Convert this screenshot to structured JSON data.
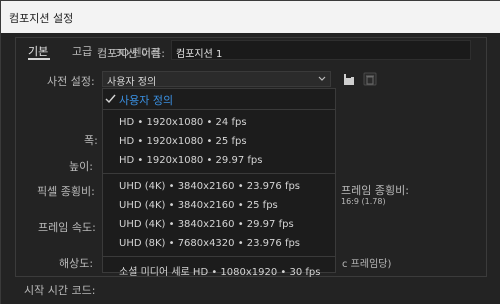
{
  "window": {
    "title": "컴포지션 설정"
  },
  "composition": {
    "name_label": "컴포지션 이름:",
    "name_value": "컴포지션 1"
  },
  "tabs": [
    "기본",
    "고급",
    "3D 렌더러"
  ],
  "form": {
    "preset_label": "사전 설정:",
    "width_label": "폭:",
    "height_label": "높이:",
    "pixel_aspect_label": "픽셀 종횡비:",
    "frame_rate_label": "프레임 속도:",
    "resolution_label": "해상도:",
    "start_timecode_label": "시작 시간 코드:"
  },
  "preset": {
    "value": "사용자 정의"
  },
  "right": {
    "frame_aspect_label": "프레임 종횡비:",
    "frame_aspect_value": "16:9 (1.78)",
    "per_frame_text": "c 프레임당)"
  },
  "dropdown": {
    "items": [
      {
        "label": "사용자 정의",
        "selected": true
      },
      {
        "label": "HD • 1920x1080 • 24 fps"
      },
      {
        "label": "HD • 1920x1080 • 25 fps"
      },
      {
        "label": "HD • 1920x1080 • 29.97 fps"
      },
      {
        "label": "UHD (4K) • 3840x2160 • 23.976 fps"
      },
      {
        "label": "UHD (4K) • 3840x2160 • 25 fps"
      },
      {
        "label": "UHD (4K) • 3840x2160 • 29.97 fps"
      },
      {
        "label": "UHD (8K) • 7680x4320 • 23.976 fps"
      },
      {
        "label": "소셜 미디어 세로 HD • 1080x1920 • 30 fps"
      }
    ]
  },
  "colors": {
    "background": "#232323",
    "titlebar": "#f3f3f3",
    "accent": "#3a8fe0"
  },
  "icons": [
    "chevron-down-icon",
    "save-preset-icon",
    "trash-icon",
    "checkmark-icon"
  ]
}
